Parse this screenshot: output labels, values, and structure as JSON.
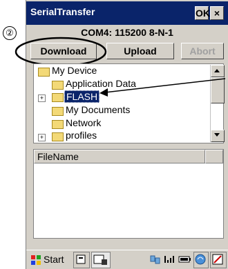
{
  "window": {
    "title": "SerialTransfer",
    "ok_label": "OK",
    "close_label": "×"
  },
  "connection": {
    "label": "COM4: 115200 8-N-1"
  },
  "toolbar": {
    "download_label": "Download",
    "upload_label": "Upload",
    "abort_label": "Abort"
  },
  "tree": {
    "items": [
      {
        "label": "My Device"
      },
      {
        "label": "Application Data"
      },
      {
        "label": "FLASH"
      },
      {
        "label": "My Documents"
      },
      {
        "label": "Network"
      },
      {
        "label": "profiles"
      }
    ]
  },
  "file_list": {
    "column_header": "FileName"
  },
  "taskbar": {
    "start_label": "Start"
  },
  "annotation": {
    "step_number": "②"
  }
}
